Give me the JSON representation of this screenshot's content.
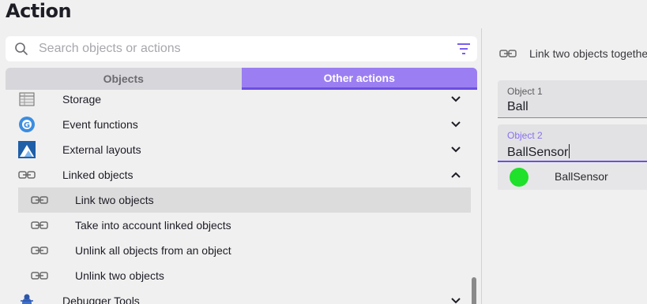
{
  "dialog": {
    "title": "Action"
  },
  "search": {
    "placeholder": "Search objects or actions",
    "value": ""
  },
  "tabs": [
    {
      "label": "Objects",
      "active": false
    },
    {
      "label": "Other actions",
      "active": true
    }
  ],
  "list": {
    "items": [
      {
        "label": "Storage",
        "icon": "storage-icon",
        "expanded": false
      },
      {
        "label": "Event functions",
        "icon": "event-functions-icon",
        "expanded": false
      },
      {
        "label": "External layouts",
        "icon": "external-layouts-icon",
        "expanded": false
      },
      {
        "label": "Linked objects",
        "icon": "link-icon",
        "expanded": true
      },
      {
        "label": "Link two objects",
        "icon": "link-icon",
        "selected": true
      },
      {
        "label": "Take into account linked objects",
        "icon": "link-icon"
      },
      {
        "label": "Unlink all objects from an object",
        "icon": "link-icon"
      },
      {
        "label": "Unlink two objects",
        "icon": "link-icon"
      },
      {
        "label": "Debugger Tools",
        "icon": "bug-icon",
        "expanded": false
      }
    ]
  },
  "action_panel": {
    "description": "Link two objects together",
    "fields": [
      {
        "label": "Object 1",
        "value": "Ball"
      },
      {
        "label": "Object 2",
        "value": "BallSensor"
      }
    ],
    "suggestion": {
      "label": "BallSensor",
      "color": "#1fe02a"
    }
  },
  "colors": {
    "accent": "#9b7ff2",
    "accent_dark": "#6b4fe0"
  }
}
